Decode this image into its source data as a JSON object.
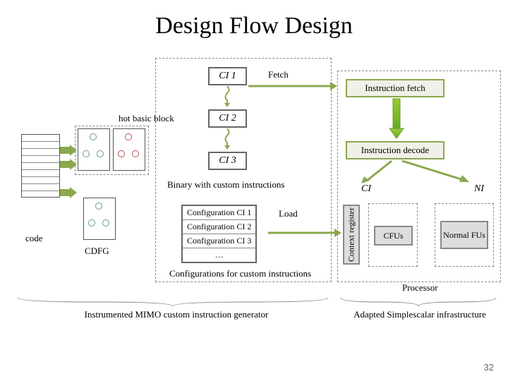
{
  "title": "Design Flow Design",
  "ci": {
    "ci1": "CI 1",
    "ci2": "CI 2",
    "ci3": "CI 3"
  },
  "labels": {
    "fetch": "Fetch",
    "hot": "hot basic block",
    "binary": "Binary with custom instructions",
    "code": "code",
    "cdfg": "CDFG",
    "load": "Load",
    "ci_col": "CI",
    "ni_col": "NI",
    "context": "Context register",
    "cfus": "CFUs",
    "normal_fus": "Normal FUs",
    "processor": "Processor",
    "cfg_for": "Configurations for custom instructions",
    "left_brace": "Instrumented MIMO custom instruction generator",
    "right_brace": "Adapted Simplescalar infrastructure"
  },
  "proc": {
    "ifetch": "Instruction fetch",
    "idecode": "Instruction decode"
  },
  "cfg": {
    "c1": "Configuration CI 1",
    "c2": "Configuration CI 2",
    "c3": "Configuration CI 3",
    "dots": "…"
  },
  "slide_num": "32"
}
